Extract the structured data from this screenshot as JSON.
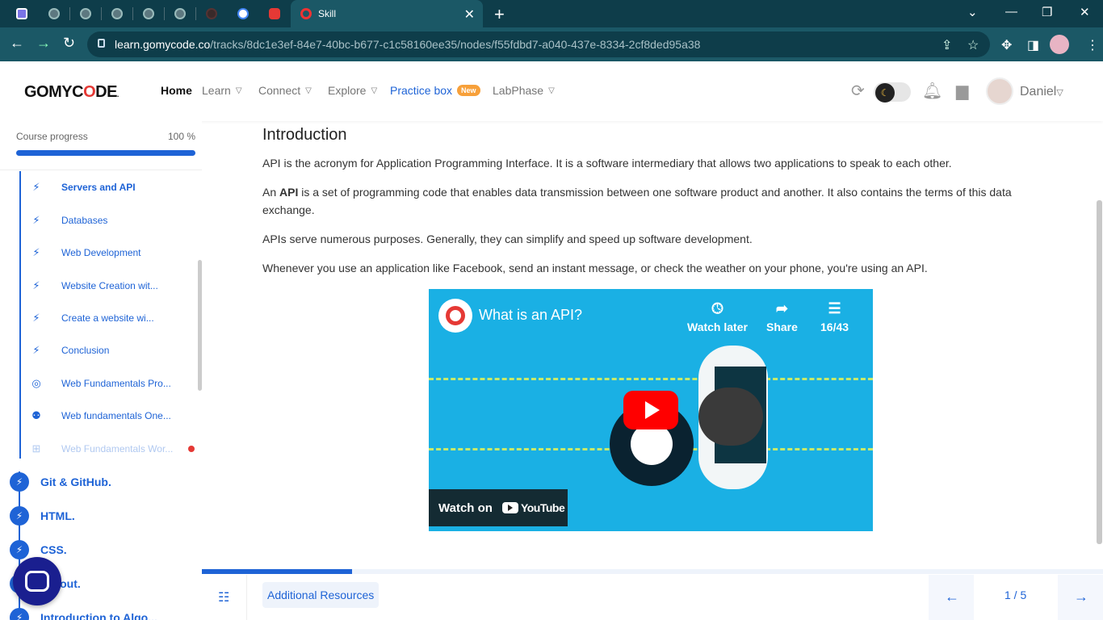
{
  "browser": {
    "active_tab_title": "Skill",
    "url_host": "learn.gomycode.co",
    "url_path": "/tracks/8dc1e3ef-84e7-40bc-b677-c1c58160ee35/nodes/f55fdbd7-a040-437e-8334-2cf8ded95a38"
  },
  "header": {
    "logo": "GOMYCODE",
    "nav": {
      "home": "Home",
      "learn": "Learn",
      "connect": "Connect",
      "explore": "Explore",
      "practice": "Practice box",
      "practice_badge": "New",
      "labphase": "LabPhase"
    },
    "username": "Daniel"
  },
  "sidebar": {
    "progress_label": "Course progress",
    "progress_value": "100 %",
    "progress_fraction": 1.0,
    "sub_items": [
      {
        "label": "Servers and API",
        "icon": "bolt-icon"
      },
      {
        "label": "Databases",
        "icon": "bolt-icon"
      },
      {
        "label": "Web Development",
        "icon": "bolt-icon"
      },
      {
        "label": "Website Creation wit...",
        "icon": "bolt-icon"
      },
      {
        "label": "Create a website wi...",
        "icon": "bolt-icon"
      },
      {
        "label": "Conclusion",
        "icon": "bolt-icon"
      },
      {
        "label": "Web Fundamentals Pro...",
        "icon": "target-icon"
      },
      {
        "label": "Web fundamentals One...",
        "icon": "people-icon"
      },
      {
        "label": "Web Fundamentals Wor...",
        "icon": "workshop-icon"
      }
    ],
    "modules": [
      {
        "label": "Git & GitHub."
      },
      {
        "label": "HTML."
      },
      {
        "label": "CSS."
      },
      {
        "label": "Layout."
      },
      {
        "label": "Introduction to Algo..."
      }
    ]
  },
  "content": {
    "title": "Introduction",
    "p1": "API is the acronym for Application Programming Interface. It is a software intermediary that allows two applications to speak to each other.",
    "p2_prefix": "An ",
    "p2_bold": "API",
    "p2_rest": " is a set of programming code that enables data transmission between one software product and another. It also contains the terms of this data exchange.",
    "p3": "APIs serve numerous purposes. Generally, they can simplify and speed up software development.",
    "p4": "Whenever you use an application like Facebook, send an instant message, or check the weather on your phone, you're using an API.",
    "video": {
      "title": "What is an API?",
      "watch_later": "Watch later",
      "share": "Share",
      "playlist": "16/43",
      "watch_on": "Watch on",
      "youtube": "YouTube"
    }
  },
  "bottom": {
    "resources": "Additional Resources",
    "page": "1 / 5",
    "progress_fraction": 0.167
  },
  "colors": {
    "accent": "#1e63d6",
    "browser_dark": "#0e3d4a",
    "browser_mid": "#1b5866",
    "badge": "#f7a03a"
  }
}
